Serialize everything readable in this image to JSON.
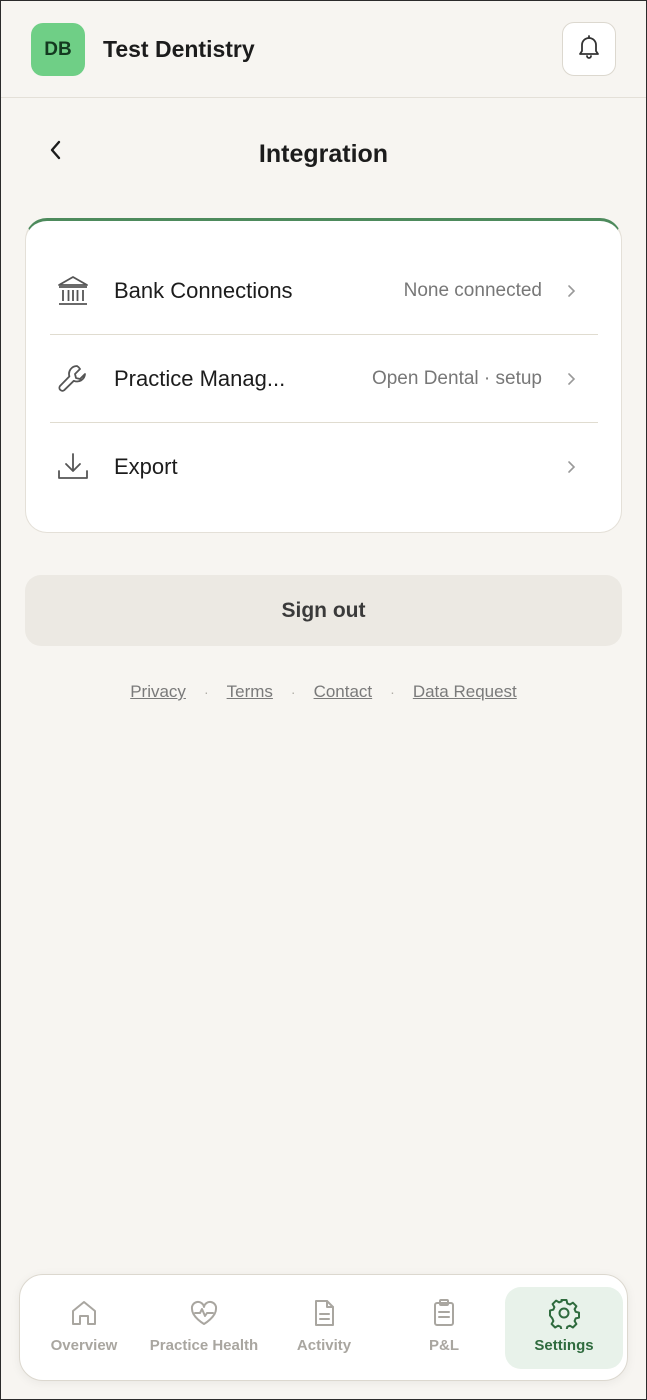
{
  "header": {
    "avatar_initials": "DB",
    "practice_name": "Test Dentistry",
    "notifications_icon": "bell-icon"
  },
  "page": {
    "title": "Integration",
    "back_icon": "chevron-left-icon"
  },
  "integration_rows": [
    {
      "icon": "bank-icon",
      "label": "Bank Connections",
      "value": "None connected"
    },
    {
      "icon": "wrench-icon",
      "label": "Practice Manag...",
      "value": "Open Dental · setup"
    },
    {
      "icon": "download-icon",
      "label": "Export",
      "value": ""
    }
  ],
  "sign_out_label": "Sign out",
  "footer_links": [
    "Privacy",
    "Terms",
    "Contact",
    "Data Request"
  ],
  "footer_separator": "·",
  "bottom_nav": [
    {
      "icon": "home-icon",
      "label": "Overview",
      "active": false
    },
    {
      "icon": "heart-pulse-icon",
      "label": "Practice Health",
      "active": false
    },
    {
      "icon": "document-icon",
      "label": "Activity",
      "active": false
    },
    {
      "icon": "clipboard-icon",
      "label": "P&L",
      "active": false
    },
    {
      "icon": "gear-icon",
      "label": "Settings",
      "active": true
    }
  ],
  "colors": {
    "accent": "#4d8a5c",
    "avatar_bg": "#6fcf86",
    "background": "#f7f5f1",
    "active_nav_bg": "#e8f2ea"
  }
}
